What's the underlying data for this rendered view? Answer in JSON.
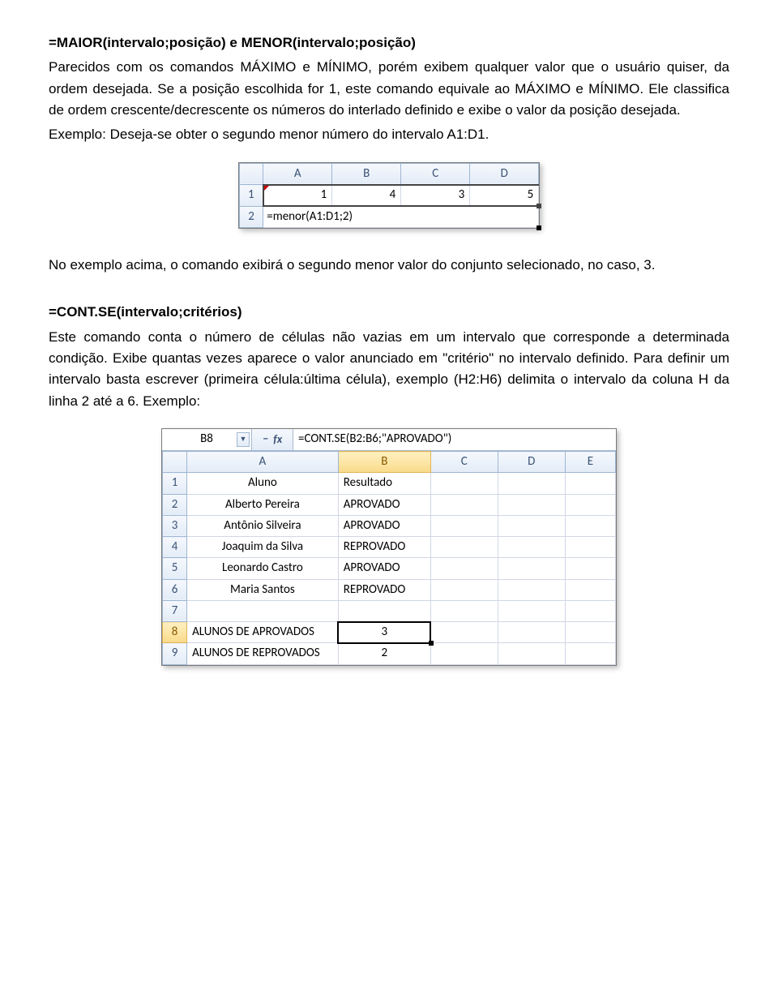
{
  "heading1": "=MAIOR(intervalo;posição) e MENOR(intervalo;posição)",
  "p1": "Parecidos com os comandos MÁXIMO e MÍNIMO, porém exibem qualquer valor que o usuário quiser, da ordem desejada. Se a posição escolhida for 1, este comando equivale ao MÁXIMO e MÍNIMO. Ele classifica de ordem crescente/decrescente os números do interlado definido e exibe o valor da posição desejada.",
  "p2": "Exemplo: Deseja-se obter o segundo menor número do intervalo A1:D1.",
  "excel1": {
    "cols": [
      "A",
      "B",
      "C",
      "D"
    ],
    "rows": [
      "1",
      "2"
    ],
    "row1": [
      "1",
      "4",
      "3",
      "5"
    ],
    "formula": "=menor(A1:D1;2)"
  },
  "p3": "No exemplo acima, o comando exibirá o segundo menor valor do conjunto selecionado, no caso, 3.",
  "heading2": "=CONT.SE(intervalo;critérios)",
  "p4": "Este comando conta o número de células não vazias em um intervalo que corresponde a determinada condição. Exibe quantas vezes aparece o valor anunciado em \"critério\" no intervalo definido. Para definir um intervalo basta escrever (primeira célula:última célula), exemplo (H2:H6) delimita o intervalo da coluna H da linha 2 até a 6. Exemplo:",
  "excel2": {
    "namebox": "B8",
    "fx_label": "fx",
    "dd_glyph": "▼",
    "dash": "–",
    "formula": "=CONT.SE(B2:B6;\"APROVADO\")",
    "cols": [
      "A",
      "B",
      "C",
      "D",
      "E"
    ],
    "rowheads": [
      "1",
      "2",
      "3",
      "4",
      "5",
      "6",
      "7",
      "8",
      "9"
    ],
    "header_row": [
      "Aluno",
      "Resultado"
    ],
    "data": [
      [
        "Alberto Pereira",
        "APROVADO"
      ],
      [
        "Antônio Silveira",
        "APROVADO"
      ],
      [
        "Joaquim da Silva",
        "REPROVADO"
      ],
      [
        "Leonardo Castro",
        "APROVADO"
      ],
      [
        "Maria Santos",
        "REPROVADO"
      ]
    ],
    "summary": [
      {
        "label": "ALUNOS DE APROVADOS",
        "value": "3"
      },
      {
        "label": "ALUNOS DE REPROVADOS",
        "value": "2"
      }
    ]
  }
}
